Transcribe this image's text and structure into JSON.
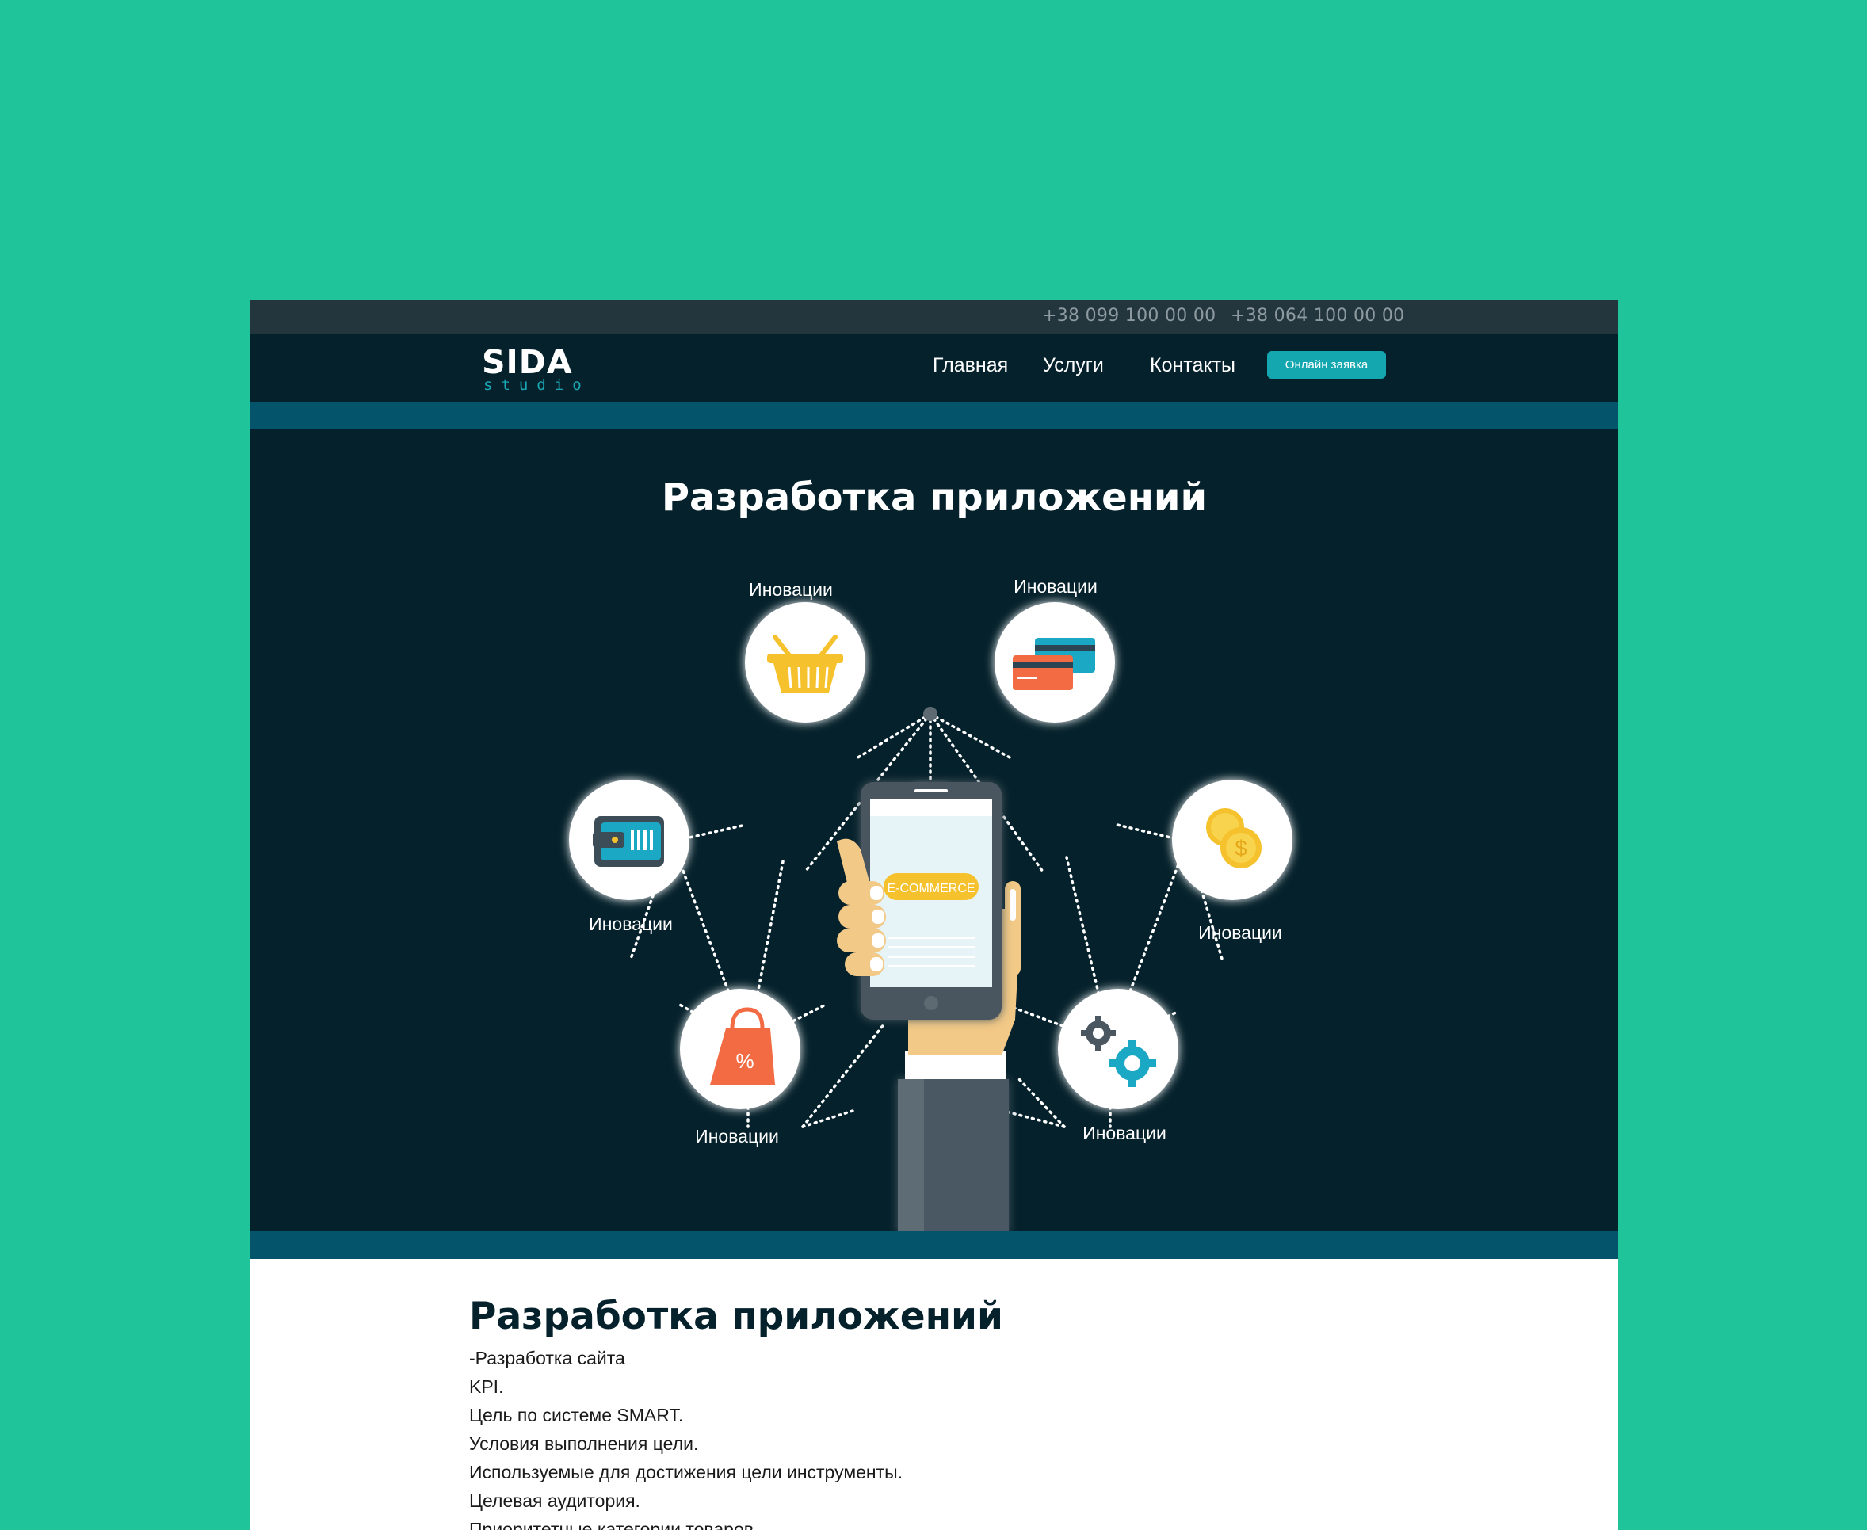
{
  "topbar": {
    "phones": [
      "+38 099 100 00 00",
      "+38 064 100 00 00"
    ]
  },
  "logo": {
    "main": "SIDA",
    "sub": "studio"
  },
  "nav": {
    "items": [
      {
        "label": "Главная"
      },
      {
        "label": "Услуги"
      },
      {
        "label": "Контакты"
      }
    ],
    "cta_label": "Онлайн заявка"
  },
  "hero": {
    "title": "Разработка приложений",
    "phone_badge": "E-COMMERCE",
    "nodes": [
      {
        "label": "Иновации",
        "icon": "shopping-basket-icon"
      },
      {
        "label": "Иновации",
        "icon": "credit-cards-icon"
      },
      {
        "label": "Иновации",
        "icon": "wallet-icon"
      },
      {
        "label": "Иновации",
        "icon": "coins-icon"
      },
      {
        "label": "Иновации",
        "icon": "shopping-bag-percent-icon"
      },
      {
        "label": "Иновации",
        "icon": "gears-icon"
      }
    ]
  },
  "content": {
    "title": "Разработка приложений",
    "lines": [
      "-Разработка сайта",
      "KPI.",
      "Цель по системе SMART.",
      "Условия выполнения цели.",
      "Используемые для достижения цели инструменты.",
      "Целевая аудитория.",
      "Приоритетные категории товаров."
    ]
  },
  "colors": {
    "background": "#20c49b",
    "navbar": "#05222c",
    "hero": "#05212b",
    "stripe": "#04546b",
    "accent": "#15a7b0"
  }
}
